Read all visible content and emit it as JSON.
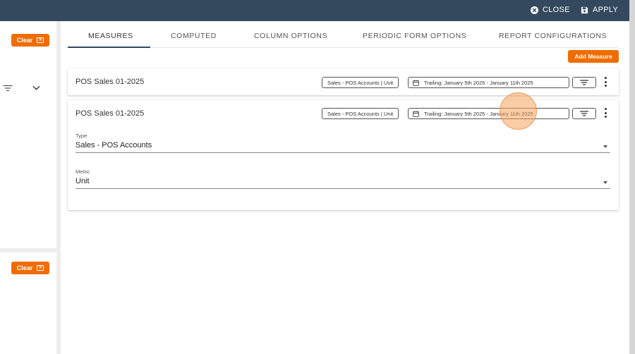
{
  "topbar": {
    "close_label": "CLOSE",
    "apply_label": "APPLY",
    "background": "#34495e"
  },
  "sidebar": {
    "clear_top_label": "Clear",
    "clear_bottom_label": "Clear",
    "accent": "#ef6c00",
    "icons": [
      "filter-icon",
      "chevron-down-icon"
    ]
  },
  "tabs": [
    {
      "label": "MEASURES",
      "active": true
    },
    {
      "label": "COMPUTED",
      "active": false
    },
    {
      "label": "COLUMN OPTIONS",
      "active": false
    },
    {
      "label": "PERIODIC FORM OPTIONS",
      "active": false
    },
    {
      "label": "REPORT CONFIGURATIONS",
      "active": false
    }
  ],
  "add_measure_label": "Add Measure",
  "measures": [
    {
      "title": "POS Sales 01-2025",
      "type_chip": "Sales - POS Accounts | Unit",
      "date_chip": "Trailing: January 5th 2025 - January 11th 2025",
      "expanded": false
    },
    {
      "title": "POS Sales 01-2025",
      "type_chip": "Sales - POS Accounts | Unit",
      "date_chip": "Trailing: January 5th 2025 - January 11th 2025",
      "expanded": true,
      "type_label": "Type",
      "type_value": "Sales - POS Accounts",
      "metric_label": "Metric",
      "metric_value": "Unit"
    }
  ]
}
